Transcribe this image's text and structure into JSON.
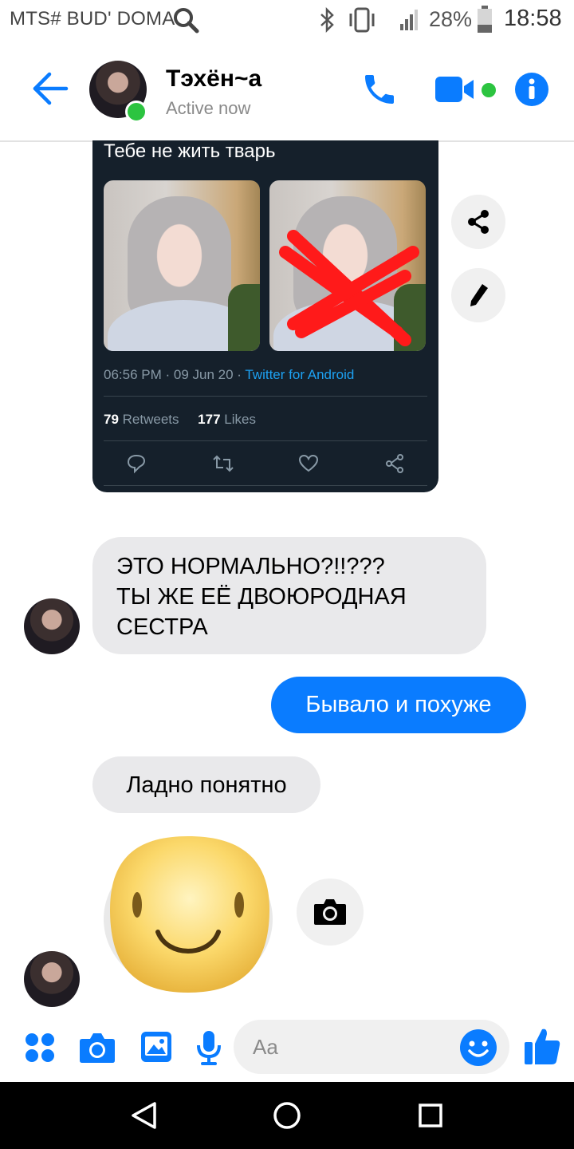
{
  "status_bar": {
    "carrier": "MTS# BUD' DOMA",
    "battery_percent": "28%",
    "time": "18:58"
  },
  "header": {
    "contact_name": "Тэхён~a",
    "status": "Active now"
  },
  "tweet": {
    "text": "Тебе не жить тварь",
    "time": "06:56 PM · 09 Jun 20 · ",
    "source": "Twitter for Android",
    "retweets_count": "79",
    "retweets_label": "Retweets",
    "likes_count": "177",
    "likes_label": "Likes"
  },
  "messages": [
    {
      "from": "contact",
      "text": "ЭТО НОРМАЛЬНО?!!???\nТЫ ЖЕ ЕЁ ДВОЮРОДНАЯ\nСЕСТРА"
    },
    {
      "from": "me",
      "text": "Бывало и похуже"
    },
    {
      "from": "contact",
      "text": "Ладно понятно"
    },
    {
      "from": "contact",
      "text": "",
      "sticker": "smiley-sticker"
    }
  ],
  "composer": {
    "placeholder": "Aa"
  },
  "colors": {
    "messenger_blue": "#0a7cff",
    "active_green": "#2cc440",
    "tweet_bg": "#15202b",
    "twitter_blue": "#1da1f2",
    "bubble_gray": "#e9e9eb"
  }
}
